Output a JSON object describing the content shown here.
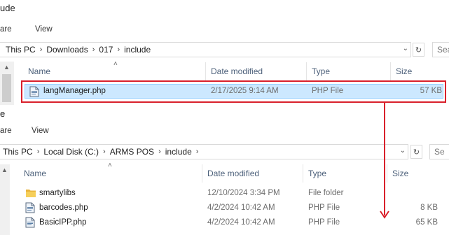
{
  "top": {
    "title_fragment": "ude",
    "ribbon": {
      "share": "are",
      "view": "View"
    },
    "address": [
      "This PC",
      "Downloads",
      "017",
      "include"
    ],
    "search_placeholder": "Sea",
    "columns": {
      "name": "Name",
      "date": "Date modified",
      "type": "Type",
      "size": "Size"
    },
    "files": [
      {
        "name": "langManager.php",
        "date": "2/17/2025 9:14 AM",
        "type": "PHP File",
        "size": "57 KB",
        "icon": "php-file-icon"
      }
    ]
  },
  "bottom": {
    "title_fragment": "e",
    "ribbon": {
      "share": "are",
      "view": "View"
    },
    "address": [
      "This PC",
      "Local Disk (C:)",
      "ARMS POS",
      "include"
    ],
    "search_placeholder": "Se",
    "columns": {
      "name": "Name",
      "date": "Date modified",
      "type": "Type",
      "size": "Size"
    },
    "files": [
      {
        "name": "smartylibs",
        "date": "12/10/2024 3:34 PM",
        "type": "File folder",
        "size": "",
        "icon": "folder-icon"
      },
      {
        "name": "barcodes.php",
        "date": "4/2/2024 10:42 AM",
        "type": "PHP File",
        "size": "8 KB",
        "icon": "php-file-icon"
      },
      {
        "name": "BasicIPP.php",
        "date": "4/2/2024 10:42 AM",
        "type": "PHP File",
        "size": "65 KB",
        "icon": "php-file-icon"
      }
    ]
  },
  "annotation": {
    "highlight_color": "#d9202b",
    "arrow_color": "#d9202b"
  },
  "icons": {
    "chevron_down": "chevron-down-icon",
    "refresh": "refresh-icon",
    "sort_up": "sort-up-icon"
  }
}
